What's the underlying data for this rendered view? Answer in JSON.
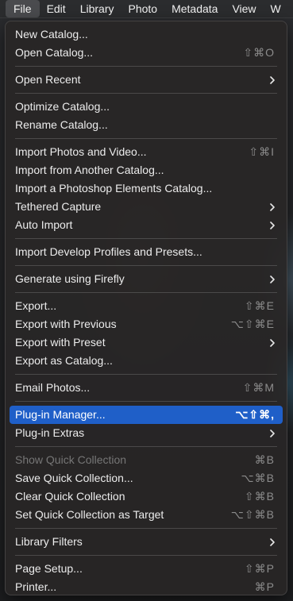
{
  "menubar": {
    "items": [
      "File",
      "Edit",
      "Library",
      "Photo",
      "Metadata",
      "View",
      "W"
    ]
  },
  "menu": {
    "groups": [
      [
        {
          "label": "New Catalog...",
          "shortcut": ""
        },
        {
          "label": "Open Catalog...",
          "shortcut": "⇧⌘O"
        }
      ],
      [
        {
          "label": "Open Recent",
          "submenu": true
        }
      ],
      [
        {
          "label": "Optimize Catalog...",
          "shortcut": ""
        },
        {
          "label": "Rename Catalog...",
          "shortcut": ""
        }
      ],
      [
        {
          "label": "Import Photos and Video...",
          "shortcut": "⇧⌘I"
        },
        {
          "label": "Import from Another Catalog...",
          "shortcut": ""
        },
        {
          "label": "Import a Photoshop Elements Catalog...",
          "shortcut": ""
        },
        {
          "label": "Tethered Capture",
          "submenu": true
        },
        {
          "label": "Auto Import",
          "submenu": true
        }
      ],
      [
        {
          "label": "Import Develop Profiles and Presets...",
          "shortcut": ""
        }
      ],
      [
        {
          "label": "Generate using Firefly",
          "submenu": true
        }
      ],
      [
        {
          "label": "Export...",
          "shortcut": "⇧⌘E"
        },
        {
          "label": "Export with Previous",
          "shortcut": "⌥⇧⌘E"
        },
        {
          "label": "Export with Preset",
          "submenu": true
        },
        {
          "label": "Export as Catalog...",
          "shortcut": ""
        }
      ],
      [
        {
          "label": "Email Photos...",
          "shortcut": "⇧⌘M"
        }
      ],
      [
        {
          "label": "Plug-in Manager...",
          "shortcut": "⌥⇧⌘,",
          "selected": true
        },
        {
          "label": "Plug-in Extras",
          "submenu": true
        }
      ],
      [
        {
          "label": "Show Quick Collection",
          "shortcut": "⌘B",
          "disabled": true
        },
        {
          "label": "Save Quick Collection...",
          "shortcut": "⌥⌘B"
        },
        {
          "label": "Clear Quick Collection",
          "shortcut": "⇧⌘B"
        },
        {
          "label": "Set Quick Collection as Target",
          "shortcut": "⌥⇧⌘B"
        }
      ],
      [
        {
          "label": "Library Filters",
          "submenu": true
        }
      ],
      [
        {
          "label": "Page Setup...",
          "shortcut": "⇧⌘P"
        },
        {
          "label": "Printer...",
          "shortcut": "⌘P"
        }
      ]
    ]
  },
  "colors": {
    "highlight": "#1f5fc8",
    "menu_bg": "#282626",
    "text": "#ececec",
    "disabled_text": "#767676"
  }
}
